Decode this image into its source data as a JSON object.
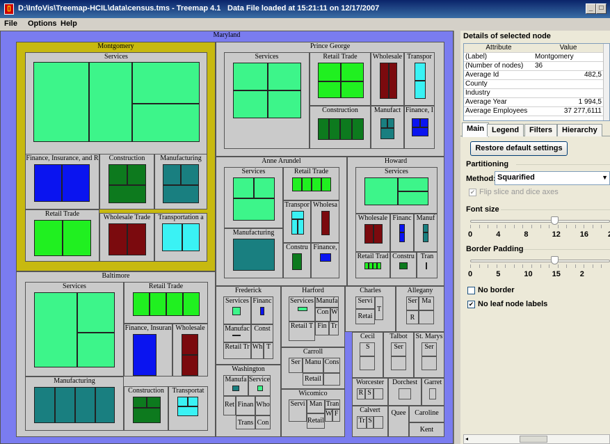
{
  "window": {
    "title": "D:\\InfoVis\\Treemap-HCIL\\data\\census.tms - Treemap 4.1",
    "status": "Data File loaded at 15:21:11 on 12/17/2007",
    "app_icon": "treemap-app-icon",
    "controls": [
      "_",
      "□",
      "×"
    ]
  },
  "menu": {
    "items": [
      "File",
      "Options",
      "Help"
    ]
  },
  "colors": {
    "services": "#3df58a",
    "retail": "#20f020",
    "finance": "#0a14f0",
    "construction": "#0d7a1e",
    "manufacturing": "#197f80",
    "wholesale": "#7b0a0e",
    "transport": "#3af2f4",
    "root": "#7a7cf0",
    "selected": "#c7b910"
  },
  "treemap": {
    "root_label": "Maryland",
    "counties": {
      "montgomery": {
        "label": "Montgomery",
        "cells": [
          "Services",
          "Finance, Insurance, and R",
          "Construction",
          "Manufacturing",
          "Retail Trade",
          "Wholesale Trade",
          "Transportation a"
        ]
      },
      "prince_george": {
        "label": "Prince George",
        "cells": [
          "Services",
          "Retail Trade",
          "Wholesale",
          "Transpor",
          "Construction",
          "Manufact",
          "Finance, I"
        ]
      },
      "anne_arundel": {
        "label": "Anne Arundel",
        "cells": [
          "Services",
          "Retail Trade",
          "Transpor",
          "Wholesa",
          "Manufacturing",
          "Constru",
          "Finance,"
        ]
      },
      "howard": {
        "label": "Howard",
        "cells": [
          "Services",
          "Wholesale",
          "Financ",
          "Manuf",
          "Retail Trad",
          "Constru",
          "Tran"
        ]
      },
      "baltimore": {
        "label": "Baltimore",
        "cells": [
          "Services",
          "Retail Trade",
          "Finance, Insuran",
          "Wholesale",
          "Manufacturing",
          "Construction",
          "Transportat"
        ]
      },
      "frederick": {
        "label": "Frederick",
        "cells": [
          "Services",
          "Financ",
          "Manufac",
          "Const",
          "Retail Tr",
          "Wh",
          "T"
        ]
      },
      "harford": {
        "label": "Harford",
        "cells": [
          "Services",
          "Manufa",
          "Con",
          "W",
          "Retail T",
          "Fin",
          "Tr"
        ]
      },
      "charles": {
        "label": "Charles",
        "cells": [
          "Servi",
          "T",
          "Retai"
        ]
      },
      "allegany": {
        "label": "Allegany",
        "cells": [
          "Ser",
          "Ma",
          "R"
        ]
      },
      "carroll": {
        "label": "Carroll",
        "cells": [
          "Ser",
          "Manu",
          "Cons",
          "Retail"
        ]
      },
      "cecil": {
        "label": "Cecil",
        "cells": [
          "S"
        ]
      },
      "talbot": {
        "label": "Talbot",
        "cells": [
          "Ser"
        ]
      },
      "st_marys": {
        "label": "St. Marys",
        "cells": [
          "Ser"
        ]
      },
      "washington": {
        "label": "Washington",
        "cells": [
          "Manufa",
          "Service",
          "Ret",
          "Finan",
          "Who",
          "Trans",
          "Con"
        ]
      },
      "wicomico": {
        "label": "Wicomico",
        "cells": [
          "Servi",
          "Man",
          "Tran",
          "W",
          "F",
          "Retail"
        ]
      },
      "worcester": {
        "label": "Worcester",
        "cells": [
          "R",
          "S"
        ]
      },
      "dorchester": {
        "label": "Dorchest"
      },
      "garrett": {
        "label": "Garret"
      },
      "calvert": {
        "label": "Calvert",
        "cells": [
          "Tr",
          "S"
        ]
      },
      "queen_annes": {
        "label": "Quee"
      },
      "caroline": {
        "label": "Caroline"
      },
      "kent": {
        "label": "Kent"
      }
    }
  },
  "details": {
    "title": "Details of selected node",
    "columns": [
      "Attribute",
      "Value"
    ],
    "rows": [
      {
        "attr": "(Label)",
        "value": "Montgomery"
      },
      {
        "attr": "(Number of nodes)",
        "value": "36"
      },
      {
        "attr": "Average Id",
        "value": "482,5"
      },
      {
        "attr": "County",
        "value": ""
      },
      {
        "attr": "Industry",
        "value": ""
      },
      {
        "attr": "Average Year",
        "value": "1 994,5"
      },
      {
        "attr": "Average Employees",
        "value": "37 277,6111"
      }
    ]
  },
  "tabs": [
    "Main",
    "Legend",
    "Filters",
    "Hierarchy"
  ],
  "main": {
    "restore_label": "Restore default settings",
    "partitioning_title": "Partitioning",
    "method_label": "Method:",
    "method_value": "Squarified",
    "flip_label": "Flip slice and dice axes",
    "font_size_title": "Font size",
    "font_ticks": [
      "0",
      "4",
      "8",
      "12",
      "16",
      "2"
    ],
    "font_size_value": 12,
    "border_padding_title": "Border Padding",
    "border_ticks": [
      "0",
      "5",
      "10",
      "15",
      "2"
    ],
    "border_padding_value": 15,
    "no_border_label": "No border",
    "no_border_checked": false,
    "no_leaf_label": "No leaf node labels",
    "no_leaf_checked": true,
    "check_glyph": "✔",
    "dropdown_glyph": "▼"
  }
}
